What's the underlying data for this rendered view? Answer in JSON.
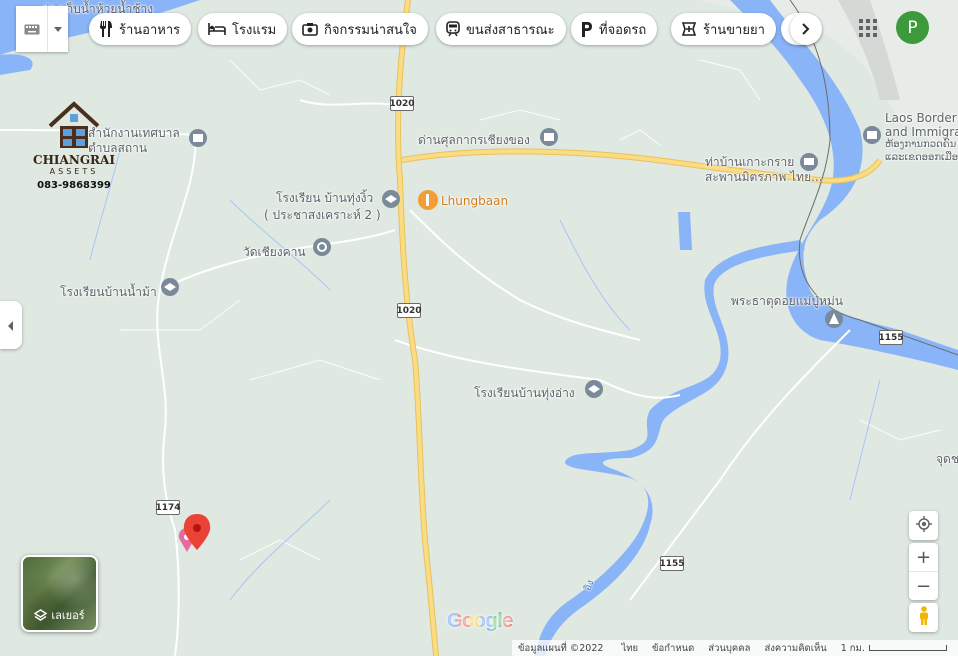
{
  "toolbar": {
    "chips": [
      {
        "label": "ร้านอาหาร",
        "icon": "fork-knife-icon"
      },
      {
        "label": "โรงแรม",
        "icon": "bed-icon"
      },
      {
        "label": "กิจกรรมน่าสนใจ",
        "icon": "camera-icon"
      },
      {
        "label": "ขนส่งสาธารณะ",
        "icon": "train-icon"
      },
      {
        "label": "ที่จอดรถ",
        "icon": "parking-icon"
      },
      {
        "label": "ร้านขายยา",
        "icon": "pharmacy-icon"
      }
    ],
    "scroll_icon": "chevron-right-icon",
    "apps_icon": "apps-grid-icon",
    "avatar_initial": "P",
    "keyboard_icon": "keyboard-icon"
  },
  "logo": {
    "name": "CHIANGRAI",
    "sub": "ASSETS",
    "phone": "083-9868399"
  },
  "map_labels": {
    "top_cut": "อ่างเก็บน้ำห้วยน้ำช้าง",
    "tessaban": "สำนักงานเทศบาลตำบลสถาน",
    "customs": "ด่านศุลกากรเชียงของ",
    "pier1": "ท่าบ้านเกาะกราย",
    "pier2": "สะพานมิตรภาพ ไทย...",
    "laos1": "Laos Border",
    "laos2": "and Immigra",
    "laos_thai1": "ຫ້ອງການກວດຄົນ",
    "laos_thai2": "ແລະເຂດອອກເມືອງ",
    "school1_a": "โรงเรียน บ้านทุ่งงิ้ว",
    "school1_b": "( ประชาสงเคราะห์ 2 )",
    "lhungbaan": "Lhungbaan",
    "wat": "วัดเชียงคาน",
    "school2": "โรงเรียนบ้านน้ำม้า",
    "phra_that": "พระธาตุดอยแม่ปู่หม่น",
    "school3": "โรงเรียนบ้านทุ่งอ่าง",
    "edge_right": "จุดชม",
    "river_label": "อิง",
    "google": "Google"
  },
  "route_shields": [
    "1020",
    "1020",
    "1174",
    "1155",
    "1155"
  ],
  "layers": {
    "label": "เลเยอร์",
    "icon": "layers-icon"
  },
  "controls": {
    "locate_icon": "my-location-icon",
    "zoom_in": "+",
    "zoom_out": "−",
    "pegman_icon": "pegman-icon",
    "collapse_icon": "chevron-left-icon"
  },
  "footer": {
    "copyright": "ข้อมูลแผนที่ ©2022",
    "lang": "ไทย",
    "terms": "ข้อกำหนด",
    "privacy": "ส่วนบุคคล",
    "feedback": "ส่งความคิดเห็น",
    "scale": "1 กม."
  },
  "colors": {
    "land": "#dfe9e2",
    "water": "#8ab4f8",
    "highway": "#fbdb84",
    "road": "#ffffff",
    "pin": "#ea4335",
    "avatar": "#3c9a3c"
  }
}
